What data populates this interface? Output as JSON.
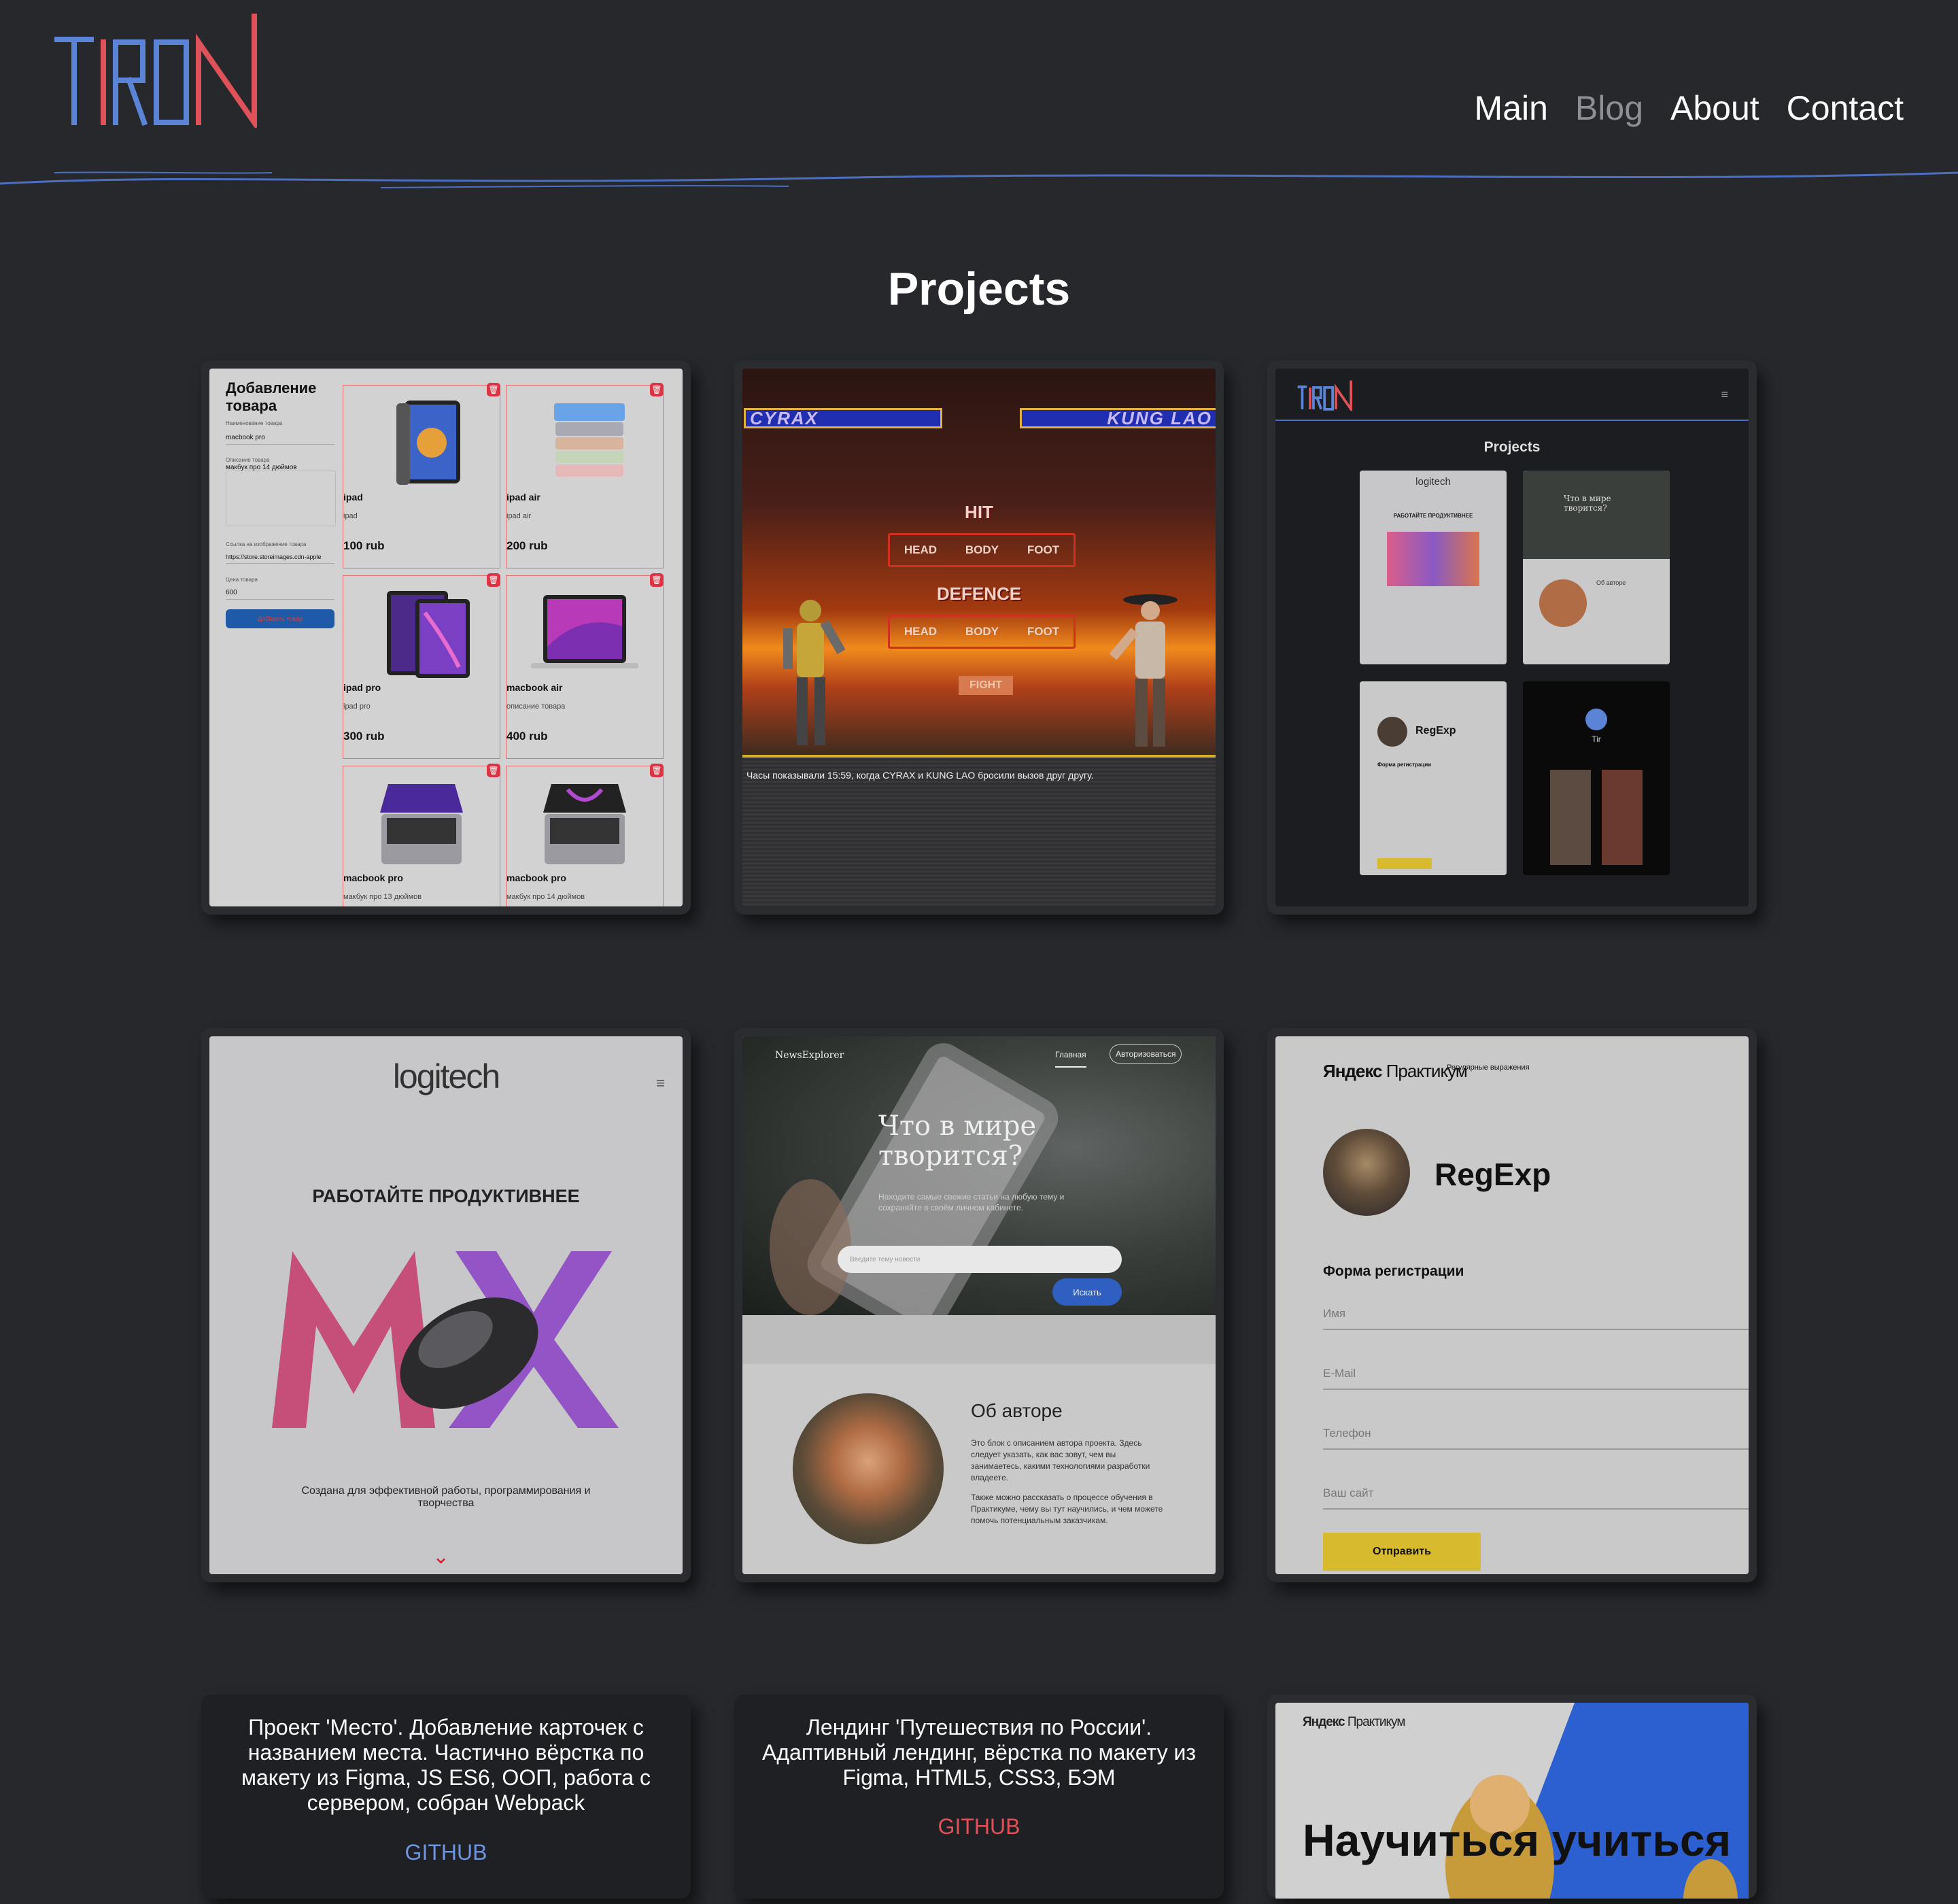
{
  "header": {
    "logo_text": "TIRON",
    "nav": [
      {
        "label": "Main",
        "active": true
      },
      {
        "label": "Blog",
        "active": false
      },
      {
        "label": "About",
        "active": true
      },
      {
        "label": "Contact",
        "active": true
      }
    ],
    "colors": {
      "logo_blue": "#5b84d6",
      "logo_red": "#e0525a",
      "line": "#4c6fc0",
      "background": "#26282c"
    }
  },
  "page_title": "Projects",
  "projects": {
    "shop": {
      "form_title": "Добавление товара",
      "name_label": "Наименование товара",
      "name_value": "macbook pro",
      "desc_label": "Описание товара",
      "desc_value": "макбук про 14 дюймов",
      "img_label": "Ссылка на изображение товара",
      "img_value": "https://store.storeimages.cdn-apple",
      "price_label": "Цена товара",
      "price_value": "600",
      "add_button": "Добавить товар",
      "products": [
        {
          "name": "ipad",
          "desc": "ipad",
          "price": "100 rub",
          "icon": "tablet"
        },
        {
          "name": "ipad air",
          "desc": "ipad air",
          "price": "200 rub",
          "icon": "tablet-stack"
        },
        {
          "name": "ipad pro",
          "desc": "ipad pro",
          "price": "300 rub",
          "icon": "tablet-pro"
        },
        {
          "name": "macbook air",
          "desc": "описание товара",
          "price": "400 rub",
          "icon": "laptop"
        },
        {
          "name": "macbook pro",
          "desc": "макбук про 13 дюймов",
          "price": "",
          "icon": "laptop"
        },
        {
          "name": "macbook pro",
          "desc": "макбук про 14 дюймов",
          "price": "",
          "icon": "laptop"
        }
      ]
    },
    "fight": {
      "player1": "CYRAX",
      "player2": "KUNG LAO",
      "hit": "HIT",
      "defence": "DEFENCE",
      "zones": [
        "HEAD",
        "BODY",
        "FOOT"
      ],
      "fight_button": "FIGHT",
      "log": "Часы показывали 15:59, когда CYRAX и KUNG LAO бросили вызов друг другу."
    },
    "portfolio": {
      "logo": "TIRON",
      "title": "Projects",
      "tiles": [
        {
          "heading": "logitech",
          "sub": "РАБОТАЙТЕ ПРОДУКТИВНЕЕ"
        },
        {
          "heading": "Что в мире творится?",
          "sub": "Об авторе"
        },
        {
          "heading": "RegExp",
          "sub": "Форма регистрации"
        },
        {
          "heading": "Tir",
          "sub": ""
        }
      ]
    },
    "logitech": {
      "logo": "logitech",
      "headline": "РАБОТАЙТЕ ПРОДУКТИВНЕЕ",
      "text": "Создана для эффективной работы, программирования и творчества",
      "mx": "MX"
    },
    "news": {
      "brand": "NewsExplorer",
      "nav_main": "Главная",
      "nav_login": "Авторизоваться",
      "headline": "Что в мире творится?",
      "subtitle": "Находите самые свежие статьи на любую тему и сохраняйте в своём личном кабинете.",
      "search_placeholder": "Введите тему новости",
      "search_button": "Искать",
      "about_title": "Об авторе",
      "about_p1": "Это блок с описанием автора проекта. Здесь следует указать, как вас зовут, чем вы занимаетесь, какими технологиями разработки владеете.",
      "about_p2": "Также можно рассказать о процессе обучения в Практикуме, чему вы тут научились, и чем можете помочь потенциальным заказчикам."
    },
    "regexp": {
      "brand_bold": "Яндекс",
      "brand_rest": "Практикум",
      "brand_sub": "Регулярные выражения",
      "name": "RegExp",
      "form_title": "Форма регистрации",
      "fields": [
        "Имя",
        "E-Mail",
        "Телефон",
        "Ваш сайт"
      ],
      "submit": "Отправить"
    },
    "mesto": {
      "description": "Проект 'Место'. Добавление карточек с названием места. Частично вёрстка по макету из Figma, JS ES6, ООП, работа с сервером, собран Webpack",
      "link": "GITHUB",
      "link_color": "#6f95e0"
    },
    "russia": {
      "description": "Лендинг 'Путешествия по России'. Адаптивный лендинг, вёрстка по макету из Figma, HTML5, CSS3, БЭМ",
      "link": "GITHUB",
      "link_color": "#e0525a"
    },
    "praktikum": {
      "brand_bold": "Яндекс",
      "brand_rest": "Практикум",
      "headline": "Научиться учиться"
    }
  }
}
